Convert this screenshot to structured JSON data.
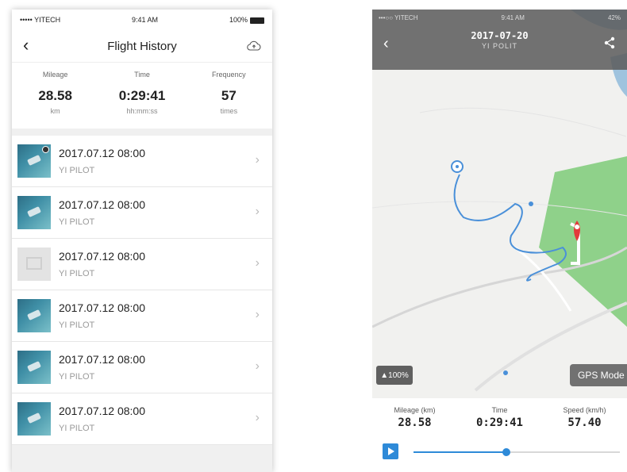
{
  "history": {
    "status": {
      "carrier": "••••• YITECH",
      "time": "9:41 AM",
      "battery": "100%"
    },
    "title": "Flight History",
    "stats": [
      {
        "label": "Mileage",
        "value": "28.58",
        "unit": "km"
      },
      {
        "label": "Time",
        "value": "0:29:41",
        "unit": "hh:mm:ss"
      },
      {
        "label": "Frequency",
        "value": "57",
        "unit": "times"
      }
    ],
    "flights": [
      {
        "date": "2017.07.12  08:00",
        "pilot": "YI PILOT",
        "thumb": "sea"
      },
      {
        "date": "2017.07.12  08:00",
        "pilot": "YI PILOT",
        "thumb": "sea"
      },
      {
        "date": "2017.07.12  08:00",
        "pilot": "YI PILOT",
        "thumb": "empty"
      },
      {
        "date": "2017.07.12  08:00",
        "pilot": "YI PILOT",
        "thumb": "sea"
      },
      {
        "date": "2017.07.12  08:00",
        "pilot": "YI PILOT",
        "thumb": "sea"
      },
      {
        "date": "2017.07.12  08:00",
        "pilot": "YI PILOT",
        "thumb": "sea"
      }
    ]
  },
  "detail": {
    "status": {
      "carrier": "•••○○ YITECH",
      "time": "9:41 AM",
      "battery": "42%"
    },
    "date": "2017-07-20",
    "pilot": "YI POLIT",
    "battery_badge": "100%",
    "gps_button": "GPS Mode",
    "stats": [
      {
        "label": "Mileage (km)",
        "value": "28.58"
      },
      {
        "label": "Time",
        "value": "0:29:41"
      },
      {
        "label": "Speed (km/h)",
        "value": "57.40"
      }
    ],
    "playback_progress": 0.45,
    "accent_color": "#2e8ad8"
  }
}
